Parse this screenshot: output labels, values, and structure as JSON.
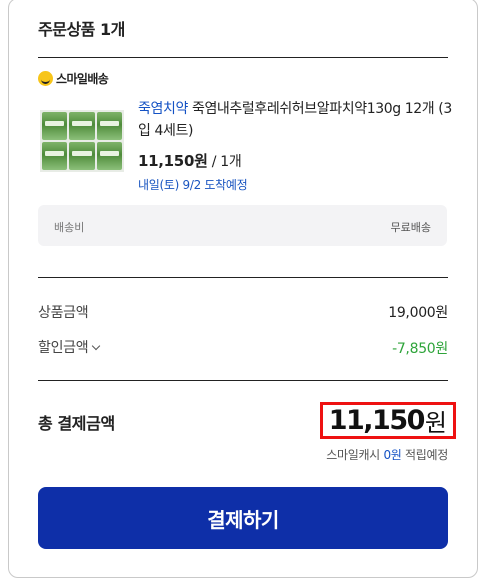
{
  "order": {
    "section_title": "주문상품 1개",
    "delivery_badge": "스마일배송",
    "product": {
      "brand": "죽염치약",
      "name_rest": " 죽염내추럴후레쉬허브알파치약130g 12개 (3입 4세트)",
      "price": "11,150원",
      "quantity": " / 1개",
      "arrival": "내일(토) 9/2 도착예정"
    },
    "shipping": {
      "label": "배송비",
      "value": "무료배송"
    }
  },
  "summary": {
    "product_amount_label": "상품금액",
    "product_amount_value": "19,000원",
    "discount_label": "할인금액",
    "discount_value": "-7,850원",
    "total_label": "총 결제금액",
    "total_amount": "11,150",
    "total_unit": "원",
    "cash_prefix": "스마일캐시 ",
    "cash_amount": "0원",
    "cash_suffix": " 적립예정"
  },
  "actions": {
    "pay_label": "결제하기"
  },
  "colors": {
    "brand_blue": "#1452c4",
    "pay_button": "#0e2fa8",
    "discount_green": "#2ea43a",
    "highlight_red": "#ee1111",
    "smile_yellow": "#f7c51a"
  },
  "icons": {
    "delivery": "smile-delivery-icon",
    "discount_toggle": "chevron-down-icon"
  }
}
